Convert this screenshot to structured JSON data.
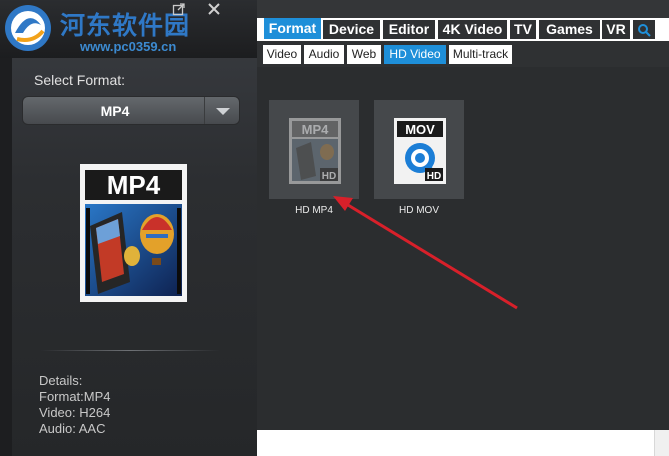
{
  "watermark": {
    "title": "河东软件园",
    "url": "www.pc0359.cn"
  },
  "left_panel": {
    "select_label": "Select Format:",
    "selected_format": "MP4",
    "preview_icon": {
      "top_text": "MP4",
      "name": "mp4-file-icon"
    },
    "details": {
      "heading": "Details:",
      "format": "Format:MP4",
      "video": "Video: H264",
      "audio": "Audio: AAC"
    }
  },
  "tabs": [
    "Format",
    "Device",
    "Editor",
    "4K Video",
    "TV",
    "Games",
    "VR"
  ],
  "active_tab": "Format",
  "subtabs": [
    "Video",
    "Audio",
    "Web",
    "HD Video",
    "Multi-track"
  ],
  "active_subtab": "HD Video",
  "formats": [
    {
      "label": "HD MP4",
      "badge": "HD",
      "top_text": "MP4",
      "icon": "hd-mp4-icon"
    },
    {
      "label": "HD MOV",
      "badge": "HD",
      "top_text": "MOV",
      "icon": "hd-mov-icon"
    }
  ],
  "colors": {
    "accent": "#1e8fd9",
    "annotation_arrow": "#d8202a"
  },
  "icons": [
    "restore-icon",
    "close-icon",
    "search-icon"
  ]
}
